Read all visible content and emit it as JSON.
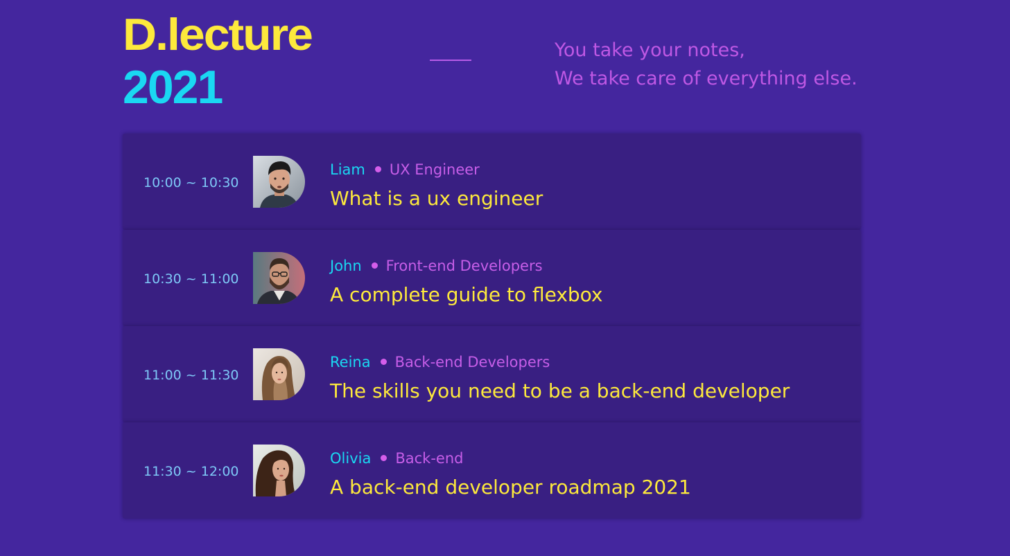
{
  "header": {
    "brand_name": "D.lecture",
    "brand_year": "2021",
    "tagline_line1": "You take your notes,",
    "tagline_line2": "We take care of everything else."
  },
  "colors": {
    "background": "#44269e",
    "card": "#391f82",
    "brand_yellow": "#fde93c",
    "accent_cyan": "#1ad8f2",
    "accent_purple": "#c75ee8",
    "time_blue": "#7ec9f7"
  },
  "sessions": [
    {
      "time": "10:00 ~ 10:30",
      "avatar": "speaker-photo-liam",
      "speaker": "Liam",
      "role": "UX Engineer",
      "title": "What is a ux engineer"
    },
    {
      "time": "10:30 ~ 11:00",
      "avatar": "speaker-photo-john",
      "speaker": "John",
      "role": "Front-end Developers",
      "title": "A complete guide to flexbox"
    },
    {
      "time": "11:00 ~ 11:30",
      "avatar": "speaker-photo-reina",
      "speaker": "Reina",
      "role": "Back-end Developers",
      "title": "The skills you need to be a back-end developer"
    },
    {
      "time": "11:30 ~ 12:00",
      "avatar": "speaker-photo-olivia",
      "speaker": "Olivia",
      "role": "Back-end",
      "title": "A back-end developer roadmap 2021"
    }
  ]
}
